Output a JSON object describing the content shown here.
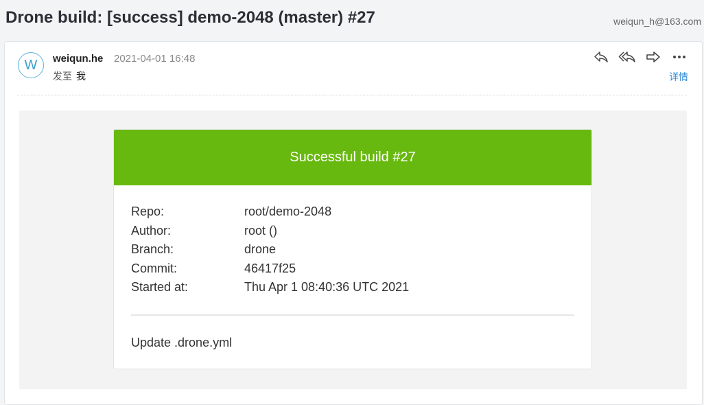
{
  "mail": {
    "subject": "Drone build: [success] demo-2048 (master) #27",
    "account": "weiqun_h@163.com",
    "sender": {
      "initial": "W",
      "name": "weiqun.he",
      "time": "2021-04-01 16:48"
    },
    "recipient": {
      "prefix": "发至",
      "to": "我"
    },
    "actions": [
      {
        "icon": "reply-icon"
      },
      {
        "icon": "reply-all-icon"
      },
      {
        "icon": "forward-icon"
      },
      {
        "icon": "more-icon"
      }
    ],
    "details_label": "详情"
  },
  "build": {
    "header": "Successful build #27",
    "header_color": "#68b90f",
    "fields": [
      {
        "label": "Repo:",
        "value": "root/demo-2048"
      },
      {
        "label": "Author:",
        "value": "root ()"
      },
      {
        "label": "Branch:",
        "value": "drone"
      },
      {
        "label": "Commit:",
        "value": "46417f25"
      },
      {
        "label": "Started at:",
        "value": "Thu Apr 1 08:40:36 UTC 2021"
      }
    ],
    "message": "Update .drone.yml"
  }
}
